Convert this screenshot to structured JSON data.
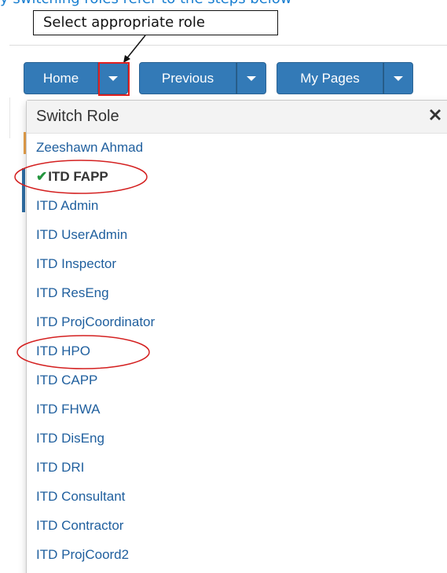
{
  "heading_clipped": "y switching roles refer to the steps below",
  "callout": {
    "text": "Select appropriate role"
  },
  "toolbar": {
    "home_label": "Home",
    "previous_label": "Previous",
    "mypages_label": "My Pages"
  },
  "dropdown": {
    "title": "Switch Role",
    "close_icon": "close-icon",
    "items": [
      {
        "label": "Zeeshawn Ahmad",
        "selected": false
      },
      {
        "label": "ITD FAPP",
        "selected": true
      },
      {
        "label": "ITD Admin",
        "selected": false
      },
      {
        "label": "ITD UserAdmin",
        "selected": false
      },
      {
        "label": "ITD Inspector",
        "selected": false
      },
      {
        "label": "ITD ResEng",
        "selected": false
      },
      {
        "label": "ITD ProjCoordinator",
        "selected": false
      },
      {
        "label": "ITD HPO",
        "selected": false
      },
      {
        "label": "ITD CAPP",
        "selected": false
      },
      {
        "label": "ITD FHWA",
        "selected": false
      },
      {
        "label": "ITD DisEng",
        "selected": false
      },
      {
        "label": "ITD DRI",
        "selected": false
      },
      {
        "label": "ITD Consultant",
        "selected": false
      },
      {
        "label": "ITD Contractor",
        "selected": false
      },
      {
        "label": "ITD ProjCoord2",
        "selected": false
      }
    ]
  },
  "colors": {
    "button_blue": "#337ab7",
    "link_blue": "#1f5f9e",
    "check_green": "#23953d",
    "annotation_red": "#e02020"
  }
}
